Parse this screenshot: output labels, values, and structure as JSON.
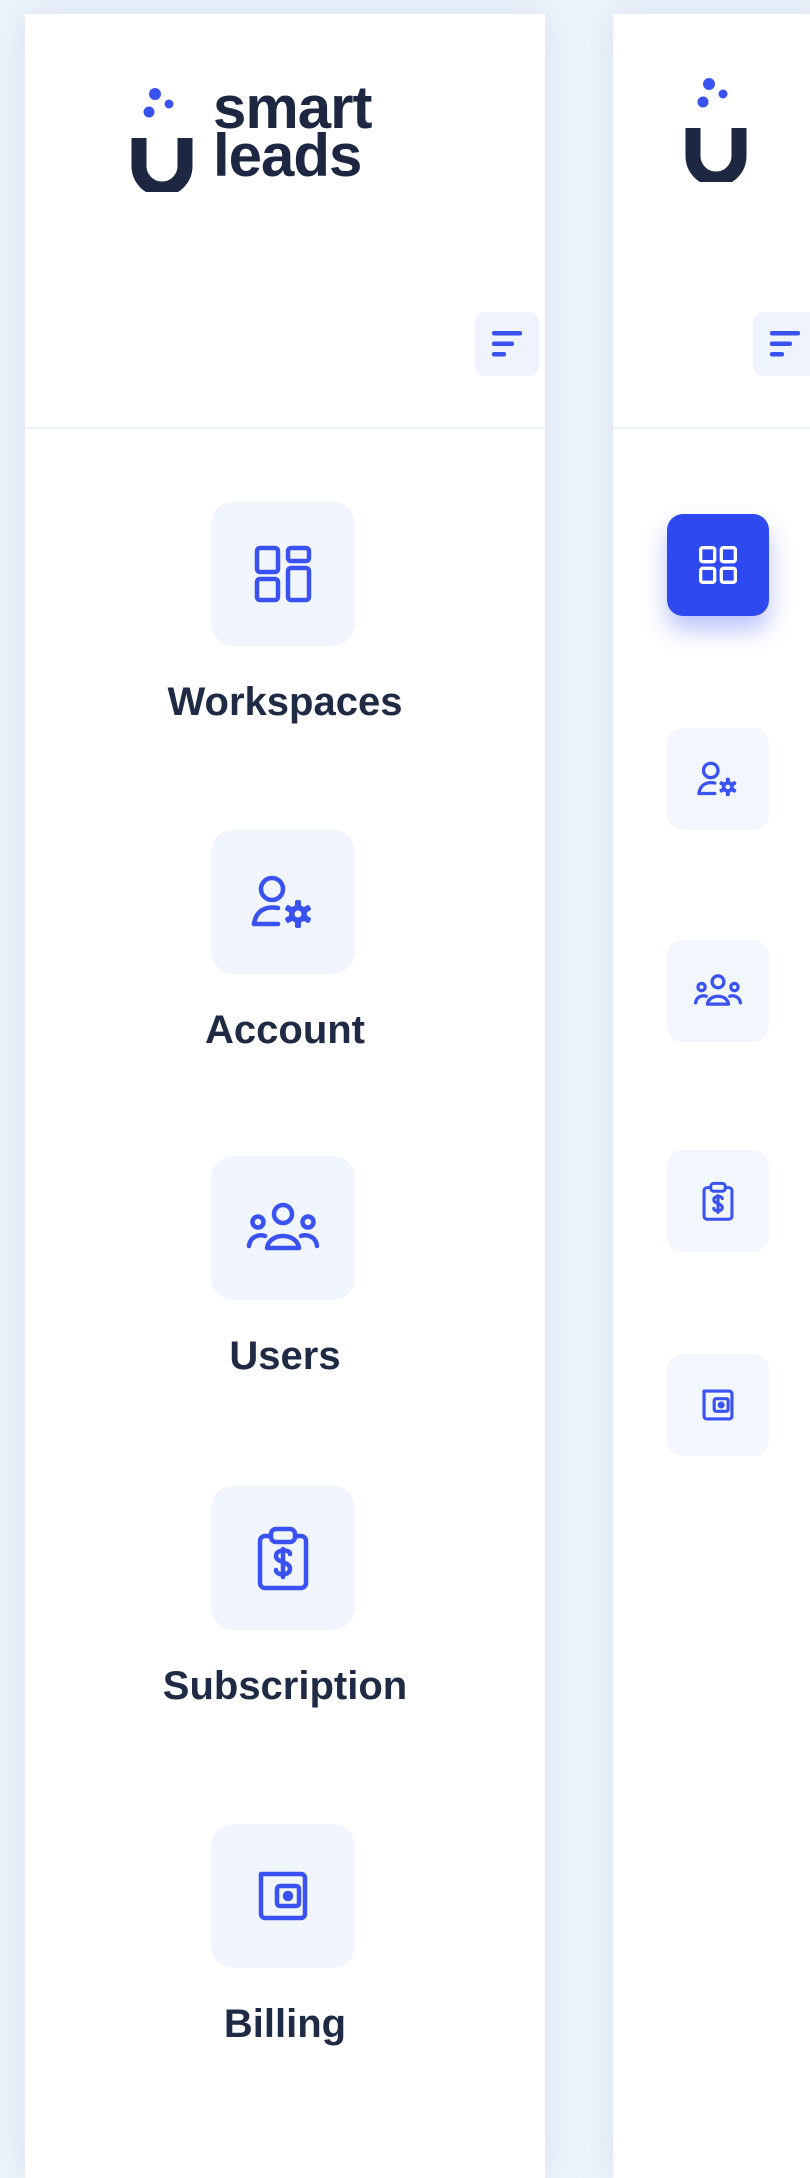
{
  "brand": {
    "line1": "smart",
    "line2": "leads"
  },
  "nav": {
    "items": [
      {
        "label": "Workspaces",
        "icon": "grid-icon"
      },
      {
        "label": "Account",
        "icon": "user-settings-icon"
      },
      {
        "label": "Users",
        "icon": "users-group-icon"
      },
      {
        "label": "Subscription",
        "icon": "clipboard-dollar-icon"
      },
      {
        "label": "Billing",
        "icon": "wallet-icon"
      }
    ],
    "active_index": 0
  },
  "colors": {
    "accent": "#2f49f0",
    "text": "#1f2b44",
    "tile": "#f1f5fd",
    "background": "#edf3fb"
  }
}
